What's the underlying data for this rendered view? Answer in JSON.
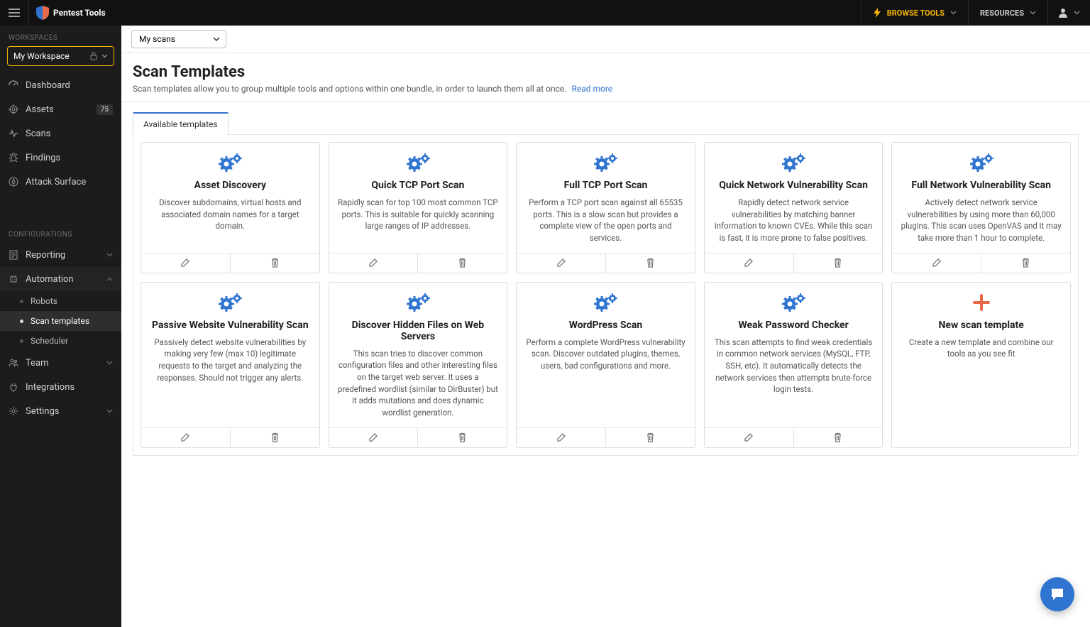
{
  "brand": "Pentest Tools",
  "topbar": {
    "browse_label": "BROWSE TOOLS",
    "resources_label": "RESOURCES"
  },
  "sidebar": {
    "workspaces_label": "WORKSPACES",
    "workspace_name": "My Workspace",
    "nav": {
      "dashboard": "Dashboard",
      "assets": "Assets",
      "assets_badge": "75",
      "scans": "Scans",
      "findings": "Findings",
      "attack_surface": "Attack Surface"
    },
    "configurations_label": "CONFIGURATIONS",
    "config": {
      "reporting": "Reporting",
      "automation": "Automation",
      "robots": "Robots",
      "scan_templates": "Scan templates",
      "scheduler": "Scheduler",
      "team": "Team",
      "integrations": "Integrations",
      "settings": "Settings"
    }
  },
  "scope_selector": "My scans",
  "page": {
    "title": "Scan Templates",
    "subtitle": "Scan templates allow you to group multiple tools and options within one bundle, in order to launch them all at once.",
    "read_more": "Read more"
  },
  "tab_label": "Available templates",
  "templates": [
    {
      "title": "Asset Discovery",
      "desc": "Discover subdomains, virtual hosts and associated domain names for a target domain."
    },
    {
      "title": "Quick TCP Port Scan",
      "desc": "Rapidly scan for top 100 most common TCP ports. This is suitable for quickly scanning large ranges of IP addresses."
    },
    {
      "title": "Full TCP Port Scan",
      "desc": "Perform a TCP port scan against all 65535 ports. This is a slow scan but provides a complete view of the open ports and services."
    },
    {
      "title": "Quick Network Vulnerability Scan",
      "desc": "Rapidly detect network service vulnerabilities by matching banner information to known CVEs. While this scan is fast, it is more prone to false positives."
    },
    {
      "title": "Full Network Vulnerability Scan",
      "desc": "Actively detect network service vulnerabilities by using more than 60,000 plugins. This scan uses OpenVAS and it may take more than 1 hour to complete."
    },
    {
      "title": "Passive Website Vulnerability Scan",
      "desc": "Passively detect website vulnerabilities by making very few (max 10) legitimate requests to the target and analyzing the responses. Should not trigger any alerts."
    },
    {
      "title": "Discover Hidden Files on Web Servers",
      "desc": "This scan tries to discover common configuration files and other interesting files on the target web server. It uses a predefined wordlist (similar to DirBuster) but it adds mutations and does dynamic wordlist generation."
    },
    {
      "title": "WordPress Scan",
      "desc": "Perform a complete WordPress vulnerability scan. Discover outdated plugins, themes, users, bad configurations and more."
    },
    {
      "title": "Weak Password Checker",
      "desc": "This scan attempts to find weak credentials in common network services (MySQL, FTP, SSH, etc). It automatically detects the network services then attempts brute-force login tests."
    }
  ],
  "new_template": {
    "title": "New scan template",
    "desc": "Create a new template and combine our tools as you see fit"
  }
}
